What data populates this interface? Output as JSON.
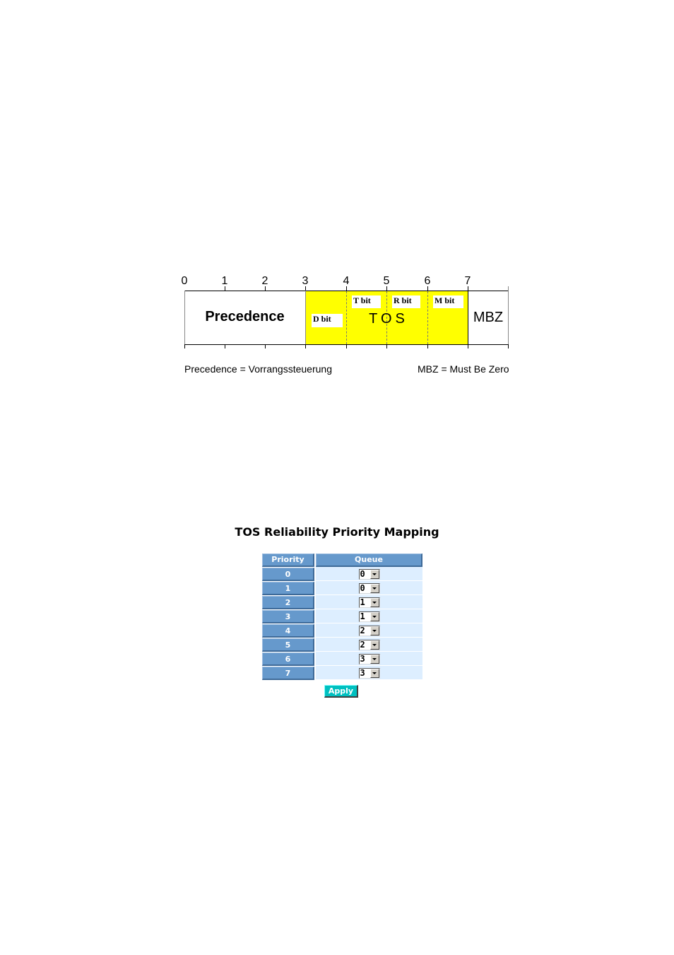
{
  "diagram": {
    "bit_positions": [
      "0",
      "1",
      "2",
      "3",
      "4",
      "5",
      "6",
      "7"
    ],
    "fields": {
      "precedence": "Precedence",
      "tos": "TOS",
      "mbz": "MBZ"
    },
    "bits": {
      "d": "D bit",
      "t": "T bit",
      "r": "R bit",
      "m": "M bit"
    },
    "colors": {
      "tos_fill": "#ffff00"
    },
    "legend": {
      "left": "Precedence = Vorrangssteuerung",
      "right": "MBZ = Must Be Zero"
    }
  },
  "panel": {
    "title": "TOS Reliability Priority Mapping",
    "columns": {
      "priority": "Priority",
      "queue": "Queue"
    },
    "rows": [
      {
        "priority": "0",
        "queue": "0"
      },
      {
        "priority": "1",
        "queue": "0"
      },
      {
        "priority": "2",
        "queue": "1"
      },
      {
        "priority": "3",
        "queue": "1"
      },
      {
        "priority": "4",
        "queue": "2"
      },
      {
        "priority": "5",
        "queue": "2"
      },
      {
        "priority": "6",
        "queue": "3"
      },
      {
        "priority": "7",
        "queue": "3"
      }
    ],
    "apply_label": "Apply",
    "colors": {
      "header_bg": "#6699cc",
      "queue_bg": "#ddeeff",
      "apply_bg": "#00c0c0"
    }
  }
}
